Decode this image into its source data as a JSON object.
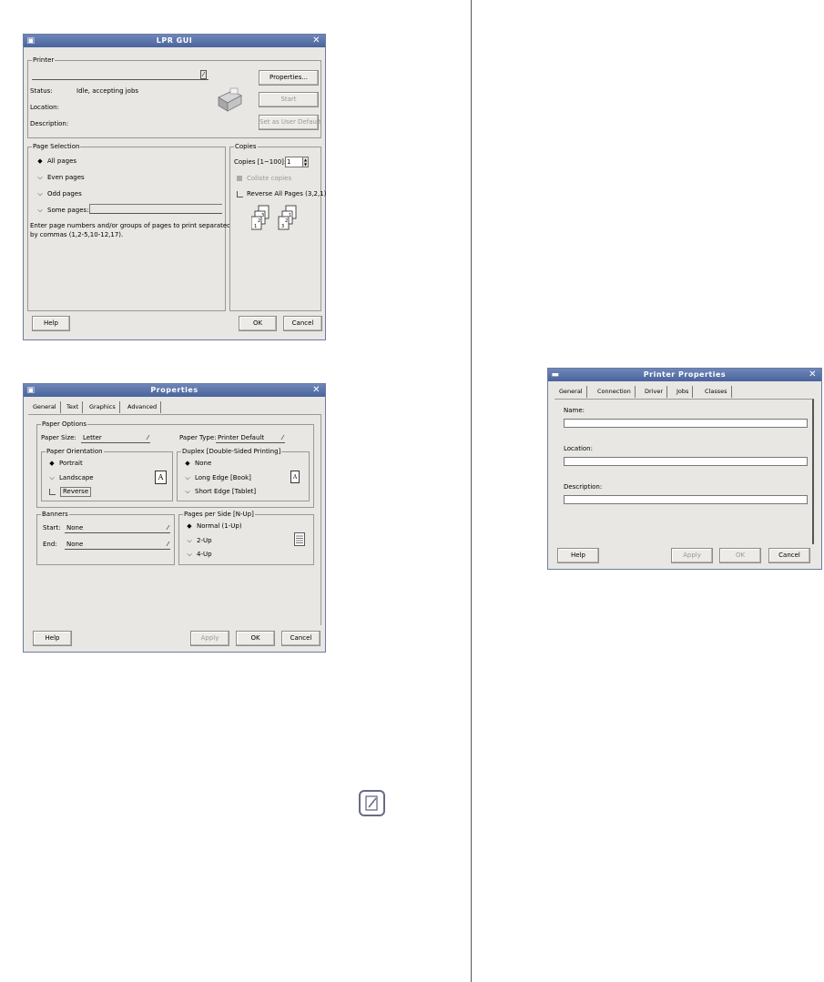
{
  "lpr": {
    "title": "LPR GUI",
    "printer_group": "Printer",
    "status_label": "Status:",
    "status_value": "Idle, accepting jobs",
    "location_label": "Location:",
    "description_label": "Description:",
    "properties_btn": "Properties...",
    "start_btn": "Start",
    "set_default_btn": "Set as User Default",
    "page_selection_group": "Page Selection",
    "all_pages": "All pages",
    "even_pages": "Even pages",
    "odd_pages": "Odd pages",
    "some_pages": "Some pages:",
    "hint_line1": "Enter page numbers and/or groups of pages to print separated",
    "hint_line2": "by commas (1,2-5,10-12,17).",
    "copies_group": "Copies",
    "copies_label": "Copies [1~100]:",
    "copies_value": "1",
    "collate": "Collate copies",
    "reverse": "Reverse All Pages (3,2,1)",
    "help_btn": "Help",
    "ok_btn": "OK",
    "cancel_btn": "Cancel"
  },
  "props": {
    "title": "Properties",
    "tabs": [
      "General",
      "Text",
      "Graphics",
      "Advanced"
    ],
    "paper_options_group": "Paper Options",
    "paper_size_label": "Paper Size:",
    "paper_size_value": "Letter",
    "paper_type_label": "Paper Type:",
    "paper_type_value": "Printer Default",
    "orientation_group": "Paper Orientation",
    "portrait": "Portrait",
    "landscape": "Landscape",
    "reverse": "Reverse",
    "duplex_group": "Duplex [Double-Sided Printing]",
    "none": "None",
    "long_edge": "Long Edge [Book]",
    "short_edge": "Short Edge [Tablet]",
    "banners_group": "Banners",
    "start_label": "Start:",
    "start_value": "None",
    "end_label": "End:",
    "end_value": "None",
    "nup_group": "Pages per Side [N-Up]",
    "normal": "Normal (1-Up)",
    "two_up": "2-Up",
    "four_up": "4-Up",
    "help_btn": "Help",
    "apply_btn": "Apply",
    "ok_btn": "OK",
    "cancel_btn": "Cancel",
    "page_glyph": "A"
  },
  "pp": {
    "title": "Printer Properties",
    "tabs": [
      "General",
      "Connection",
      "Driver",
      "Jobs",
      "Classes"
    ],
    "name_label": "Name:",
    "location_label": "Location:",
    "description_label": "Description:",
    "help_btn": "Help",
    "apply_btn": "Apply",
    "ok_btn": "OK",
    "cancel_btn": "Cancel"
  },
  "colors": {
    "titlebar": "#4a649c",
    "window_bg": "#e9e7e3",
    "divider": "#555555"
  },
  "icons": [
    "printer-icon",
    "close-icon",
    "note-icon",
    "collate-pages-icon",
    "nup-icon"
  ]
}
